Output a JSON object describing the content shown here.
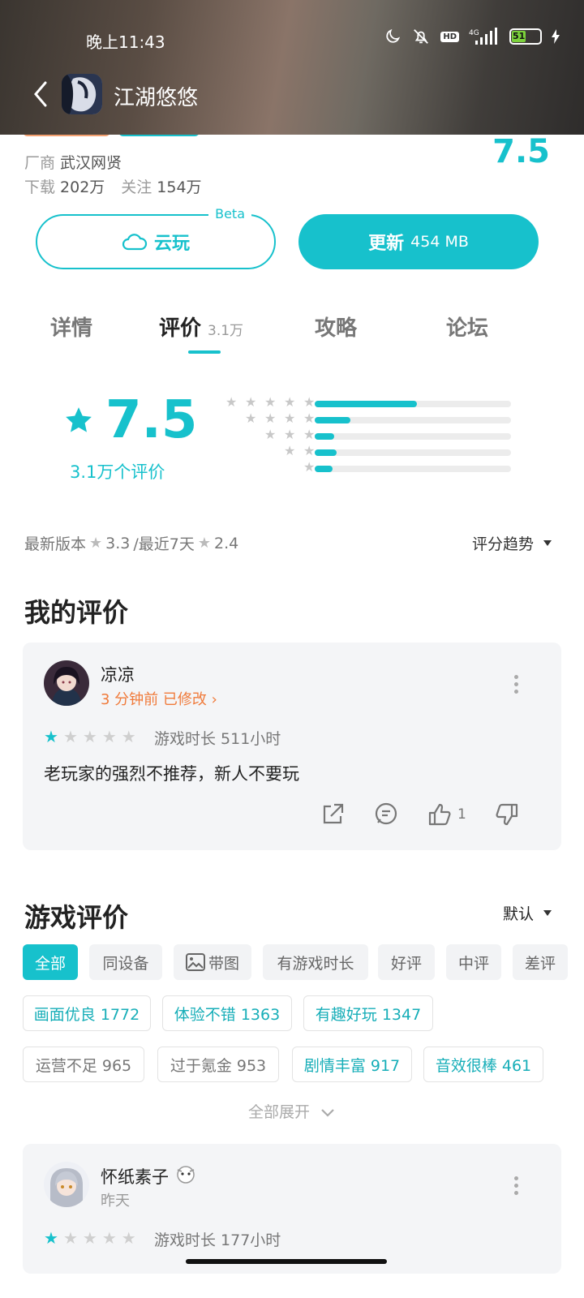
{
  "status_bar": {
    "time": "晚上11:43",
    "hd": "HD",
    "network": "4G",
    "battery": "51"
  },
  "header": {
    "title": "江湖悠悠"
  },
  "info": {
    "vendor_label": "厂商",
    "vendor": "武汉网贤",
    "download_label": "下载",
    "downloads": "202万",
    "follow_label": "关注",
    "follows": "154万",
    "score": "7.5"
  },
  "buttons": {
    "cloud_label": "云玩",
    "beta": "Beta",
    "update_label": "更新",
    "update_size": "454 MB"
  },
  "tabs": [
    {
      "label": "详情"
    },
    {
      "label": "评价",
      "count": "3.1万"
    },
    {
      "label": "攻略"
    },
    {
      "label": "论坛"
    }
  ],
  "rating": {
    "score": "7.5",
    "count_text": "3.1万个评价",
    "distribution": [
      {
        "stars": 5,
        "fraction": 0.52
      },
      {
        "stars": 4,
        "fraction": 0.18
      },
      {
        "stars": 3,
        "fraction": 0.1
      },
      {
        "stars": 2,
        "fraction": 0.11
      },
      {
        "stars": 1,
        "fraction": 0.09
      }
    ],
    "latest_version_label": "最新版本",
    "latest_version_score": "3.3",
    "recent_label": "/最近7天",
    "recent_score": "2.4",
    "trend_label": "评分趋势"
  },
  "my_review": {
    "section_title": "我的评价",
    "user": "凉凉",
    "time": "3 分钟前 已修改",
    "stars": 1,
    "playtime": "游戏时长 511小时",
    "text": "老玩家的强烈不推荐，新人不要玩",
    "likes": "1"
  },
  "game_reviews": {
    "section_title": "游戏评价",
    "sort_label": "默认",
    "filters": [
      "全部",
      "同设备",
      "带图",
      "有游戏时长",
      "好评",
      "中评",
      "差评"
    ],
    "tags": [
      {
        "label": "画面优良 1772"
      },
      {
        "label": "体验不错 1363"
      },
      {
        "label": "有趣好玩 1347"
      },
      {
        "label": "运营不足 965"
      },
      {
        "label": "过于氪金 953"
      },
      {
        "label": "剧情丰富 917"
      },
      {
        "label": "音效很棒 461"
      }
    ],
    "expand_label": "全部展开",
    "first": {
      "user": "怀纸素子",
      "time": "昨天",
      "stars": 1,
      "playtime": "游戏时长 177小时"
    }
  },
  "colors": {
    "accent": "#17c1cc",
    "orange": "#f07a3a"
  }
}
